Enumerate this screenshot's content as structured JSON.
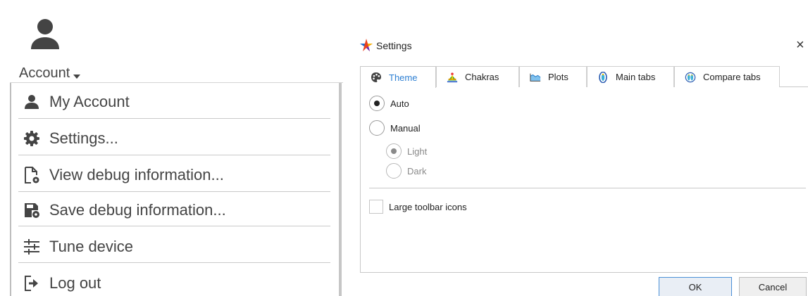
{
  "account_menu": {
    "trigger_label": "Account",
    "items": [
      {
        "label": "My Account",
        "icon": "user-icon"
      },
      {
        "label": "Settings...",
        "icon": "gear-icon"
      },
      {
        "label": "View debug information...",
        "icon": "file-gear-icon"
      },
      {
        "label": "Save debug information...",
        "icon": "save-gear-icon"
      },
      {
        "label": "Tune device",
        "icon": "sliders-icon"
      },
      {
        "label": "Log out",
        "icon": "logout-icon"
      }
    ]
  },
  "settings_dialog": {
    "title": "Settings",
    "close_glyph": "×",
    "tabs": [
      {
        "label": "Theme",
        "icon": "palette-icon",
        "active": true
      },
      {
        "label": "Chakras",
        "icon": "chakra-figure-icon",
        "active": false
      },
      {
        "label": "Plots",
        "icon": "area-chart-icon",
        "active": false
      },
      {
        "label": "Main tabs",
        "icon": "aura-icon",
        "active": false
      },
      {
        "label": "Compare tabs",
        "icon": "double-aura-icon",
        "active": false
      }
    ],
    "theme": {
      "mode_options": [
        {
          "label": "Auto",
          "selected": true
        },
        {
          "label": "Manual",
          "selected": false
        }
      ],
      "manual_options": [
        {
          "label": "Light",
          "selected": true,
          "disabled": true
        },
        {
          "label": "Dark",
          "selected": false,
          "disabled": true
        }
      ],
      "large_toolbar_icons": {
        "label": "Large toolbar icons",
        "checked": false
      }
    },
    "buttons": {
      "ok": "OK",
      "cancel": "Cancel"
    },
    "colors": {
      "active_tab": "#2d7fd3",
      "primary_border": "#4a8fd6"
    }
  }
}
